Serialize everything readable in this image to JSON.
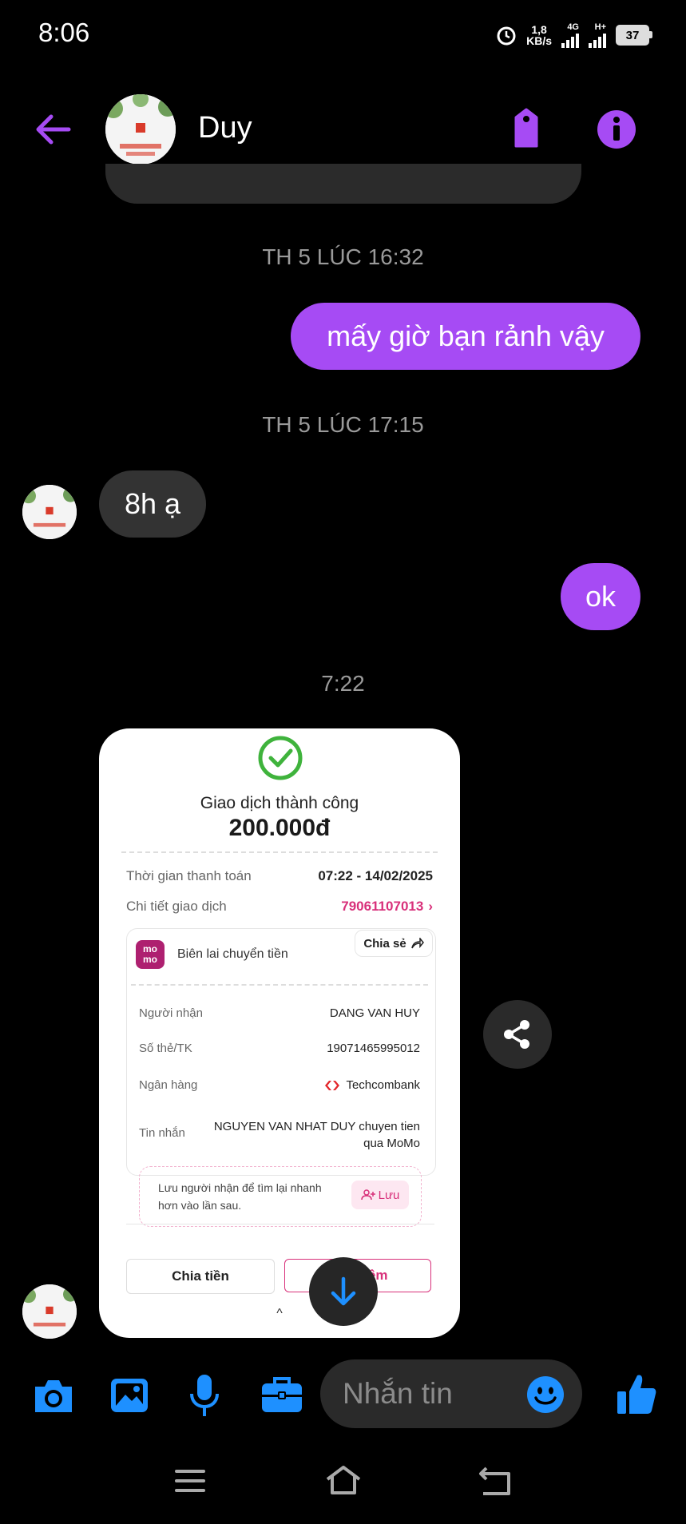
{
  "status_bar": {
    "time": "8:06",
    "speed_value": "1,8",
    "speed_unit": "KB/s",
    "network1": "4G",
    "network2": "H+",
    "battery": "37"
  },
  "header": {
    "contact_name": "Duy"
  },
  "messages": {
    "timestamp1": "TH 5 LÚC 16:32",
    "sent1": "mấy giờ bạn rảnh vậy",
    "timestamp2": "TH 5 LÚC 17:15",
    "received1": "8h ạ",
    "sent2": "ok",
    "timestamp3": "7:22"
  },
  "receipt": {
    "title": "Giao dịch thành công",
    "amount": "200.000đ",
    "payment_time_label": "Thời gian thanh toán",
    "payment_time_value": "07:22 - 14/02/2025",
    "detail_label": "Chi tiết giao dịch",
    "detail_value": "79061107013",
    "momo_logo_text": "mo mo",
    "receipt_label": "Biên lai chuyển tiền",
    "share_label": "Chia sẻ",
    "recipient_label": "Người nhận",
    "recipient_value": "DANG VAN HUY",
    "account_label": "Số thẻ/TK",
    "account_value": "19071465995012",
    "bank_label": "Ngân hàng",
    "bank_value": "Techcombank",
    "message_label": "Tin nhắn",
    "message_value_line1": "NGUYEN VAN NHAT DUY chuyen tien",
    "message_value_line2": "qua MoMo",
    "save_hint_line1": "Lưu người nhận để tìm lại nhanh",
    "save_hint_line2": "hơn vào lần sau.",
    "save_button": "Lưu",
    "split_button": "Chia tiền",
    "more_button": "hêm",
    "caret": "^"
  },
  "composer": {
    "placeholder": "Nhắn tin"
  },
  "colors": {
    "accent_purple": "#a64bf4",
    "messenger_blue": "#1e90ff",
    "momo_pink": "#d8307a"
  }
}
